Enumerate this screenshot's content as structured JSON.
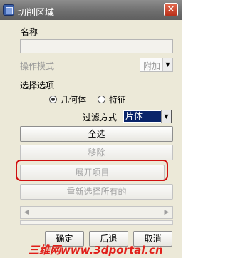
{
  "window": {
    "title": "切削区域",
    "close_icon": "close-icon"
  },
  "name_section": {
    "label": "名称",
    "value": ""
  },
  "operation_mode": {
    "label": "操作模式",
    "value": "附加"
  },
  "select_options": {
    "label": "选择选项",
    "radio_geometry": "几何体",
    "radio_feature": "特征",
    "selected": "几何体"
  },
  "filter": {
    "label": "过滤方式",
    "value": "片体"
  },
  "buttons": {
    "select_all": "全选",
    "remove": "移除",
    "expand_items": "展开项目",
    "reselect_all": "重新选择所有的",
    "ok": "确定",
    "back": "后退",
    "cancel": "取消"
  },
  "colors": {
    "highlight": "#d01010",
    "selection": "#0a246a"
  },
  "watermark": "三维网www.3dportal.cn"
}
